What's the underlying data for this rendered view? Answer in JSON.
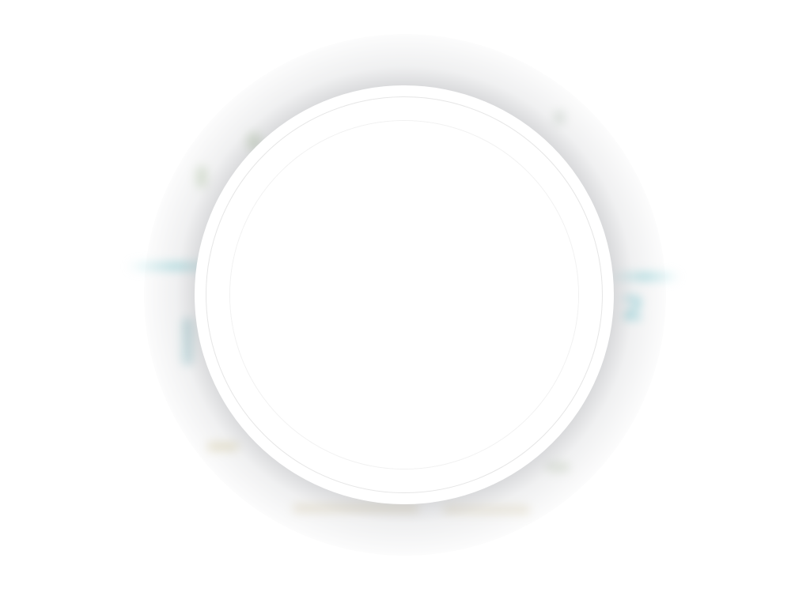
{
  "background": {
    "visible_digit": "2",
    "accent_color": "#a0dce1"
  },
  "disc": {
    "fill_color": "#ffffff",
    "ring_color": "#e6e6e6",
    "halo_color": "#46484e"
  }
}
